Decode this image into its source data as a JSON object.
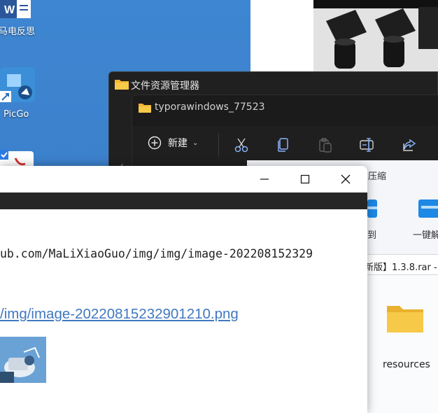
{
  "desktop": {
    "icons": [
      {
        "label": "马电反思",
        "icon": "word-doc-icon"
      },
      {
        "label": "PicGo",
        "icon": "picgo-icon"
      },
      {
        "label": "",
        "icon": "pdf-icon"
      }
    ]
  },
  "explorer": {
    "app_title": "文件资源管理器",
    "tab_title": "typorawindows_77523",
    "toolbar": {
      "new_label": "新建",
      "buttons": [
        "cut-icon",
        "copy-icon",
        "paste-icon",
        "rename-icon",
        "share-icon"
      ]
    },
    "commands": {
      "compress_label": "压缩",
      "extract_to_label": "到",
      "one_click_label": "一键解"
    },
    "path_fragment": "新版】1.3.8.rar -",
    "folder_label": "resources"
  },
  "typora": {
    "source_line": "ub.com/MaLiXiaoGuo/img/img/image-202208152329",
    "link_text": "/img/image-20220815232901210.png"
  },
  "colors": {
    "desktop_blue": "#3a7fc9",
    "explorer_dark": "#202020",
    "link_blue": "#4078c0",
    "folder_yellow": "#f7c948"
  }
}
